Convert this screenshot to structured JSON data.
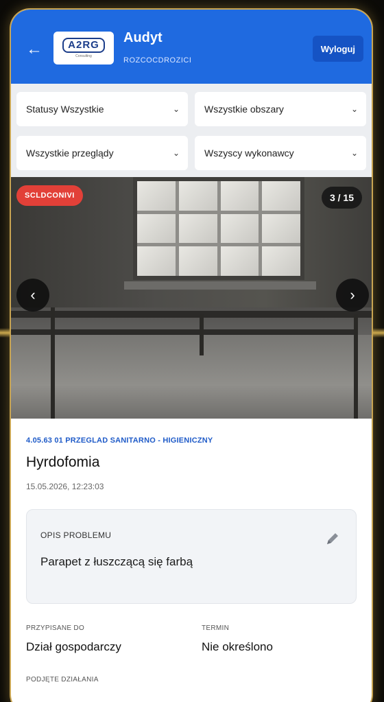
{
  "header": {
    "title": "Audyt",
    "subtitle": "ROZCOCDROZICI",
    "logo_text": "A2RG",
    "logo_sub": "Consulting",
    "logout_label": "Wyloguj"
  },
  "filters": [
    {
      "value": "Statusy Wszystkie"
    },
    {
      "value": "Wszystkie obszary"
    },
    {
      "value": "Wszystkie przeglądy"
    },
    {
      "value": "Wszyscy wykonawcy"
    }
  ],
  "photo": {
    "status_badge": "SCLDCONIVI",
    "counter": "3 / 15"
  },
  "details": {
    "category": "4.05.63 01 PRZEGLAD SANITARNO - HIGIENICZNY",
    "title": "Hyrdofomia",
    "timestamp": "15.05.2026, 12:23:03",
    "problem_label": "OPIS PROBLEMU",
    "problem_text": "Parapet z łuszczącą się farbą",
    "assigned_label": "PRZYPISANE DO",
    "assigned_value": "Dział gospodarczy",
    "deadline_label": "TERMIN",
    "deadline_value": "Nie określono",
    "next_label": "PODJĘTE DZIAŁANIA"
  },
  "colors": {
    "header_blue": "#1f6ae0",
    "badge_red": "#e24038",
    "category_blue": "#1f5bc8"
  },
  "icons": {
    "back": "arrow-left-icon",
    "prev": "chevron-left-icon",
    "next": "chevron-right-icon",
    "edit": "pencil-icon",
    "dropdown": "chevron-down-icon"
  }
}
